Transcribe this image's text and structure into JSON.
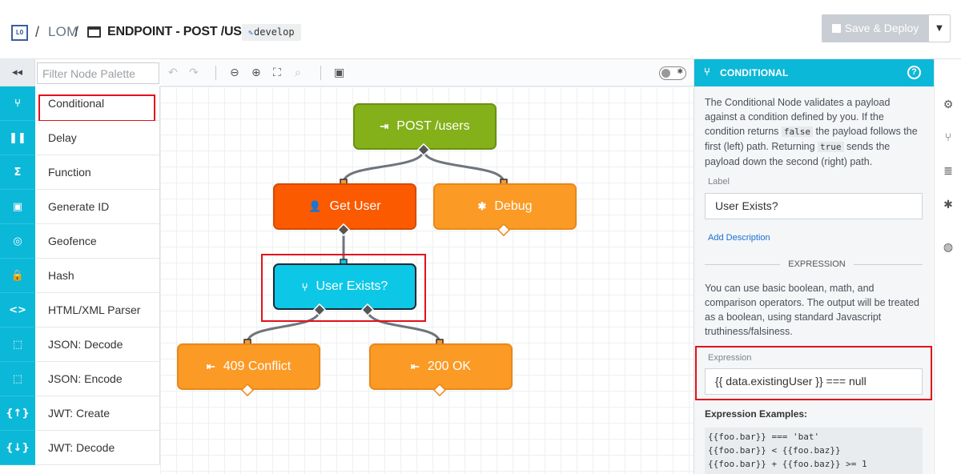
{
  "header": {
    "logo_text": "LO",
    "sep": "/",
    "app_name": "LOM",
    "resource_title": "ENDPOINT - POST /USERS",
    "branch": "develop",
    "deploy_label": "Save & Deploy"
  },
  "palette": {
    "filter_placeholder": "Filter Node Palette",
    "items": [
      {
        "label": "Conditional",
        "icon": "conditional-icon",
        "glyph": "⑂"
      },
      {
        "label": "Delay",
        "icon": "pause-icon",
        "glyph": "❚❚"
      },
      {
        "label": "Function",
        "icon": "sigma-icon",
        "glyph": "Σ"
      },
      {
        "label": "Generate ID",
        "icon": "id-card-icon",
        "glyph": "▣"
      },
      {
        "label": "Geofence",
        "icon": "crosshair-icon",
        "glyph": "◎"
      },
      {
        "label": "Hash",
        "icon": "lock-icon",
        "glyph": "🔒"
      },
      {
        "label": "HTML/XML Parser",
        "icon": "code-icon",
        "glyph": "<>"
      },
      {
        "label": "JSON: Decode",
        "icon": "json-decode-icon",
        "glyph": "⬚"
      },
      {
        "label": "JSON: Encode",
        "icon": "json-encode-icon",
        "glyph": "⬚"
      },
      {
        "label": "JWT: Create",
        "icon": "jwt-create-icon",
        "glyph": "{↑}"
      },
      {
        "label": "JWT: Decode",
        "icon": "jwt-decode-icon",
        "glyph": "{↓}"
      }
    ]
  },
  "canvas": {
    "nodes": {
      "post_users": "POST /users",
      "get_user": "Get User",
      "debug": "Debug",
      "user_exists": "User Exists?",
      "conflict": "409 Conflict",
      "ok": "200 OK"
    }
  },
  "panel": {
    "title": "CONDITIONAL",
    "desc_1": "The Conditional Node validates a payload against a condition defined by you. If the condition returns",
    "desc_false": "false",
    "desc_2": "the payload follows the first (left) path. Returning",
    "desc_true": "true",
    "desc_3": "sends the payload down the second (right) path.",
    "label_caption": "Label",
    "label_value": "User Exists?",
    "add_description": "Add Description",
    "section_title": "EXPRESSION",
    "expr_help": "You can use basic boolean, math, and comparison operators. The output will be treated as a boolean, using standard Javascript truthiness/falsiness.",
    "expr_caption": "Expression",
    "expr_value": "{{ data.existingUser }} === null",
    "examples_title": "Expression Examples:",
    "examples": [
      "{{foo.bar}} === 'bat'",
      "{{foo.bar}} < {{foo.baz}}",
      "{{foo.bar}} + {{foo.baz}} >= 1"
    ]
  },
  "colors": {
    "accent": "#0cb8d8",
    "trigger_node": "#84b01a",
    "getuser_node": "#fb5a00",
    "output_node": "#fb9a25",
    "conditional_node": "#0cc8e6",
    "highlight": "#e2111b"
  }
}
